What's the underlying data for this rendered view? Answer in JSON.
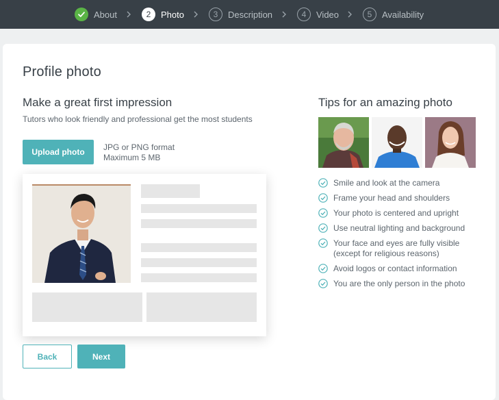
{
  "stepper": {
    "steps": [
      {
        "number": "",
        "label": "About",
        "state": "done"
      },
      {
        "number": "2",
        "label": "Photo",
        "state": "active"
      },
      {
        "number": "3",
        "label": "Description",
        "state": "todo"
      },
      {
        "number": "4",
        "label": "Video",
        "state": "todo"
      },
      {
        "number": "5",
        "label": "Availability",
        "state": "todo"
      }
    ]
  },
  "page": {
    "title": "Profile photo",
    "heading": "Make a great first impression",
    "subtitle": "Tutors who look friendly and professional get the most students"
  },
  "upload": {
    "button_label": "Upload photo",
    "format_line1": "JPG or PNG format",
    "format_line2": "Maximum 5 MB"
  },
  "nav": {
    "back_label": "Back",
    "next_label": "Next"
  },
  "tips": {
    "heading": "Tips for an amazing photo",
    "items": [
      "Smile and look at the camera",
      "Frame your head and shoulders",
      "Your photo is centered and upright",
      "Use neutral lighting and background",
      "Your face and eyes are fully visible",
      "(except for religious reasons)",
      "Avoid logos or contact information",
      "You are the only person in the photo"
    ]
  },
  "colors": {
    "accent": "#4fb2b8",
    "done_green": "#5ab446",
    "topbar": "#384047"
  }
}
